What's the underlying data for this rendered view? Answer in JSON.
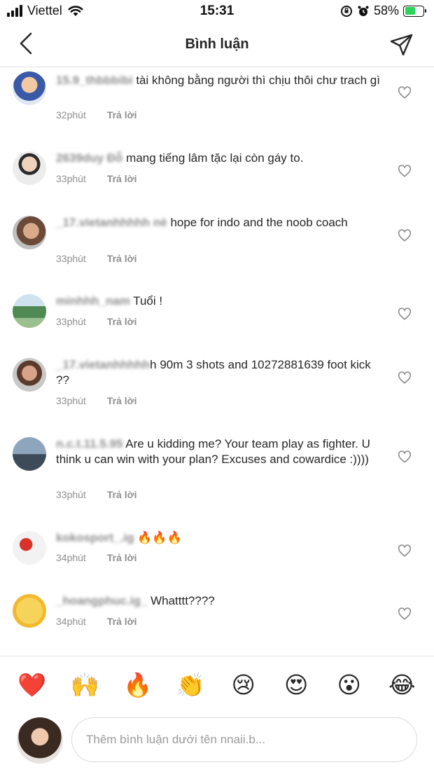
{
  "status_bar": {
    "carrier": "Viettel",
    "time": "15:31",
    "battery": "58%",
    "battery_level": 0.58
  },
  "header": {
    "title": "Bình luận",
    "back_icon": "chevron-left-icon",
    "share_icon": "paper-plane-icon"
  },
  "comments": [
    {
      "username": "15.9_thbbbibi",
      "text": "tài không bằng người thì chịu thôi chư trach gì",
      "time": "32phút",
      "reply": "Trả lời"
    },
    {
      "username": "2639duy Đỗ",
      "text": "mang tiếng lâm tặc lại còn gáy to.",
      "time": "33phút",
      "reply": "Trả lời"
    },
    {
      "username": "_17.vietanhhhhh nè",
      "text": "hope for indo and the noob coach",
      "time": "33phút",
      "reply": "Trả lời"
    },
    {
      "username": "minhhh_nam",
      "text": "Tuổi !",
      "time": "33phút",
      "reply": "Trả lời"
    },
    {
      "username": "_17.vietanhhhhh",
      "text": "h 90m 3 shots and 10272881639 foot kick ??",
      "time": "33phút",
      "reply": "Trả lời"
    },
    {
      "username": "n.c.t.11.5.95",
      "text": "Are u kidding me? Your team play as fighter. U think u can win with your plan? Excuses and cowardice :))))",
      "time": "33phút",
      "reply": "Trả lời"
    },
    {
      "username": "kokosport_.ig",
      "text": "🔥🔥🔥",
      "time": "34phút",
      "reply": "Trả lời"
    },
    {
      "username": "_hoangphuc.ig_",
      "text": "Whatttt????",
      "time": "34phút",
      "reply": "Trả lời"
    }
  ],
  "reactions": [
    "❤️",
    "🙌",
    "🔥",
    "👏",
    "😢",
    "😍",
    "😮",
    "😂"
  ],
  "input": {
    "placeholder": "Thêm bình luận dưới tên nnaii.b..."
  }
}
